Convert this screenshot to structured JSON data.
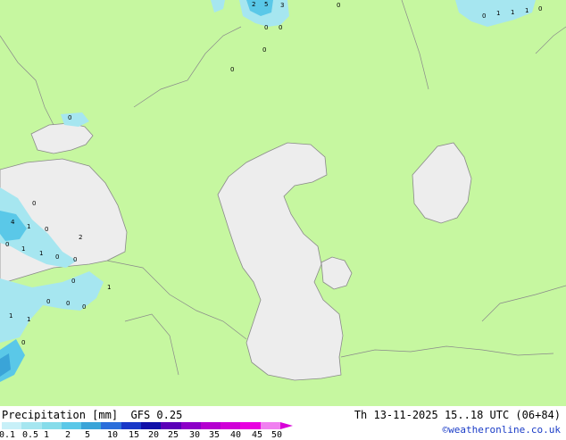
{
  "title": "Precipitation [mm]  GFS 0.25",
  "valid_time": "Th 13-11-2025 15..18 UTC (06+84)",
  "credit": "©weatheronline.co.uk",
  "colors": {
    "land": "#c6f7a0",
    "water": "#ededed",
    "light_precip": "#a6e6f0",
    "medium_precip": "#5ac8e8",
    "heavy_precip": "#3aa4d8"
  },
  "legend": {
    "labels": [
      "0.1",
      "0.5",
      "1",
      "2",
      "5",
      "10",
      "15",
      "20",
      "25",
      "30",
      "35",
      "40",
      "45",
      "50"
    ],
    "colors": [
      "#c8f0f8",
      "#a6e6f0",
      "#86dcea",
      "#5ac8e8",
      "#3aa4d8",
      "#2a6edb",
      "#1838c8",
      "#1010a8",
      "#5a00b8",
      "#8c00c8",
      "#b400d0",
      "#d000d8",
      "#e800e0",
      "#f080f0"
    ]
  },
  "point_values": [
    "2",
    "5",
    "3",
    "0",
    "0",
    "0",
    "0",
    "0",
    "0",
    "1",
    "1",
    "1",
    "0",
    "0",
    "0",
    "4",
    "1",
    "0",
    "2",
    "0",
    "1",
    "1",
    "0",
    "0",
    "0",
    "1",
    "0",
    "0",
    "0",
    "1",
    "1",
    "0"
  ]
}
